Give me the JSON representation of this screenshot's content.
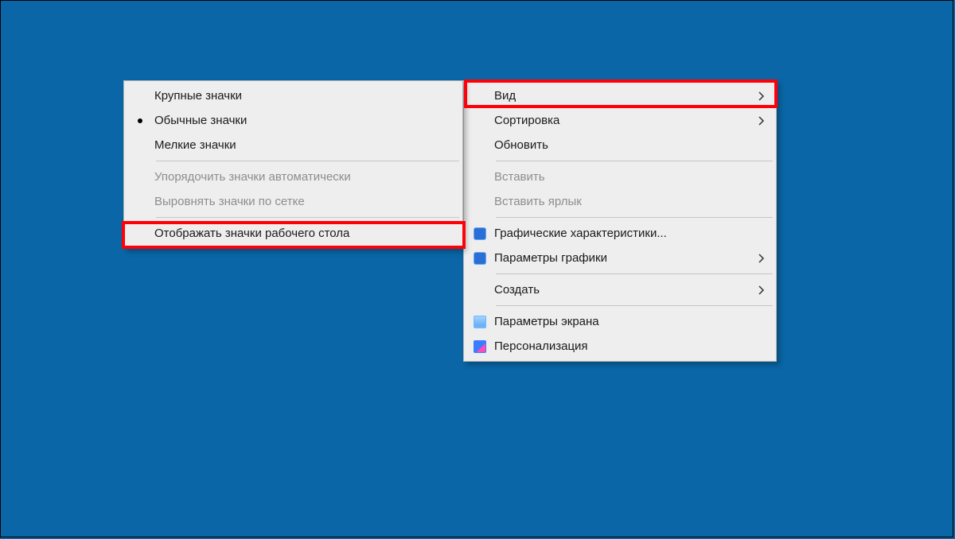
{
  "context_menu": {
    "items": [
      {
        "label": "Вид",
        "submenu": true,
        "highlighted": true
      },
      {
        "label": "Сортировка",
        "submenu": true
      },
      {
        "label": "Обновить"
      },
      {
        "sep": true
      },
      {
        "label": "Вставить",
        "disabled": true
      },
      {
        "label": "Вставить ярлык",
        "disabled": true
      },
      {
        "sep": true
      },
      {
        "label": "Графические характеристики...",
        "icon": "intel1"
      },
      {
        "label": "Параметры графики",
        "icon": "intel2",
        "submenu": true
      },
      {
        "sep": true
      },
      {
        "label": "Создать",
        "submenu": true
      },
      {
        "sep": true
      },
      {
        "label": "Параметры экрана",
        "icon": "screen"
      },
      {
        "label": "Персонализация",
        "icon": "pers"
      }
    ]
  },
  "view_submenu": {
    "items": [
      {
        "label": "Крупные значки"
      },
      {
        "label": "Обычные значки",
        "radio": true
      },
      {
        "label": "Мелкие значки"
      },
      {
        "sep": true
      },
      {
        "label": "Упорядочить значки автоматически",
        "disabled": true
      },
      {
        "label": "Выровнять значки по сетке",
        "disabled": true
      },
      {
        "sep": true
      },
      {
        "label": "Отображать значки рабочего стола",
        "highlighted": true
      }
    ]
  }
}
